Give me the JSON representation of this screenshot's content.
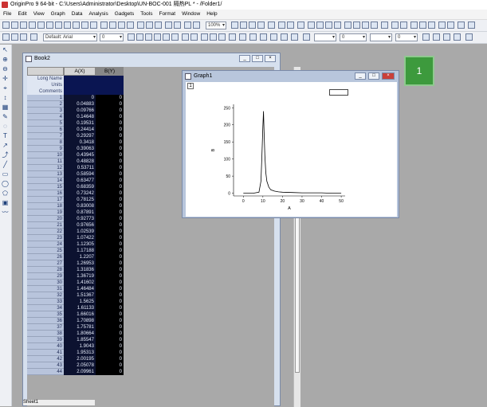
{
  "app": {
    "title": "OriginPro 9 64-bit - C:\\Users\\Administrator\\Desktop\\UN-BOC-001 隔热PL * - /Folder1/",
    "icon": "origin-app-icon"
  },
  "menu": [
    "File",
    "Edit",
    "View",
    "Graph",
    "Data",
    "Analysis",
    "Gadgets",
    "Tools",
    "Format",
    "Window",
    "Help"
  ],
  "toolbar": {
    "zoom_value": "100%",
    "font_family": "Default: Arial",
    "font_size": "0",
    "line_width": "0",
    "symbol_size": "0"
  },
  "workbook": {
    "title": "Book2",
    "columns": [
      "A(X)",
      "B(Y)"
    ],
    "header_rows": [
      "Long Name",
      "Units",
      "Comments"
    ],
    "rows": [
      [
        "1",
        "0",
        "0"
      ],
      [
        "2",
        "0.04883",
        "0"
      ],
      [
        "3",
        "0.09766",
        "0"
      ],
      [
        "4",
        "0.14648",
        "0"
      ],
      [
        "5",
        "0.19531",
        "0"
      ],
      [
        "6",
        "0.24414",
        "0"
      ],
      [
        "7",
        "0.29297",
        "0"
      ],
      [
        "8",
        "0.3418",
        "0"
      ],
      [
        "9",
        "0.39063",
        "0"
      ],
      [
        "10",
        "0.43945",
        "0"
      ],
      [
        "11",
        "0.48828",
        "0"
      ],
      [
        "12",
        "0.53711",
        "0"
      ],
      [
        "13",
        "0.58594",
        "0"
      ],
      [
        "14",
        "0.63477",
        "0"
      ],
      [
        "15",
        "0.68359",
        "0"
      ],
      [
        "16",
        "0.73242",
        "0"
      ],
      [
        "17",
        "0.78125",
        "0"
      ],
      [
        "18",
        "0.83008",
        "0"
      ],
      [
        "19",
        "0.87891",
        "0"
      ],
      [
        "20",
        "0.92773",
        "0"
      ],
      [
        "21",
        "0.97656",
        "0"
      ],
      [
        "22",
        "1.02539",
        "0"
      ],
      [
        "23",
        "1.07422",
        "0"
      ],
      [
        "24",
        "1.12305",
        "0"
      ],
      [
        "25",
        "1.17188",
        "0"
      ],
      [
        "26",
        "1.2207",
        "0"
      ],
      [
        "27",
        "1.26953",
        "0"
      ],
      [
        "28",
        "1.31836",
        "0"
      ],
      [
        "29",
        "1.36719",
        "0"
      ],
      [
        "30",
        "1.41602",
        "0"
      ],
      [
        "31",
        "1.46484",
        "0"
      ],
      [
        "32",
        "1.51367",
        "0"
      ],
      [
        "33",
        "1.5625",
        "0"
      ],
      [
        "34",
        "1.61133",
        "0"
      ],
      [
        "35",
        "1.66016",
        "0"
      ],
      [
        "36",
        "1.70898",
        "0"
      ],
      [
        "37",
        "1.75781",
        "0"
      ],
      [
        "38",
        "1.80664",
        "0"
      ],
      [
        "39",
        "1.85547",
        "0"
      ],
      [
        "40",
        "1.9043",
        "0"
      ],
      [
        "41",
        "1.95313",
        "0"
      ],
      [
        "42",
        "2.00195",
        "0"
      ],
      [
        "43",
        "2.05078",
        "0"
      ],
      [
        "44",
        "2.09961",
        "0"
      ]
    ],
    "sheet_tab": "Sheet1"
  },
  "graph": {
    "title": "Graph1",
    "layer_number": "1"
  },
  "chart_data": {
    "type": "line",
    "xlabel": "A",
    "ylabel": "B",
    "xlim": [
      -5,
      52
    ],
    "ylim": [
      -8,
      260
    ],
    "xticks": [
      0,
      10,
      20,
      30,
      40,
      50
    ],
    "yticks": [
      0,
      50,
      100,
      150,
      200,
      250
    ],
    "x": [
      0,
      5,
      8,
      9,
      9.5,
      10,
      10.3,
      10.6,
      11,
      11.5,
      12,
      13,
      14,
      16,
      18,
      20,
      25,
      30,
      35,
      40,
      45,
      50
    ],
    "y": [
      0,
      0,
      3,
      35,
      110,
      195,
      240,
      180,
      110,
      60,
      35,
      18,
      10,
      6,
      4,
      3,
      2,
      1,
      1,
      1,
      0,
      0
    ],
    "series": [
      {
        "name": "B"
      }
    ]
  },
  "badge": {
    "label": "1",
    "color": "#3d9a3d"
  }
}
